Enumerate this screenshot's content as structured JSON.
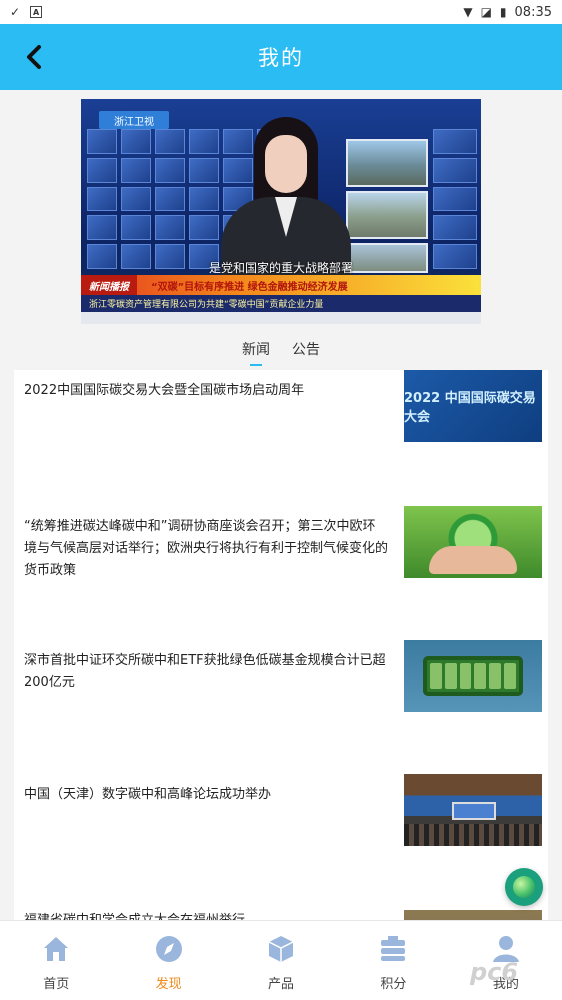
{
  "status_bar": {
    "time": "08:35"
  },
  "header": {
    "title": "我的"
  },
  "banner": {
    "channel_logo": "浙江卫视",
    "subtitle": "是党和国家的重大战略部署",
    "ticker_tag": "新闻播报",
    "ticker_text": "“双碳”目标有序推进  绿色金融推动经济发展",
    "ticker2_text": "浙江零碳资产管理有限公司为共建“零碳中国”贡献企业力量"
  },
  "tabs": [
    {
      "label": "新闻",
      "active": true
    },
    {
      "label": "公告",
      "active": false
    }
  ],
  "news": [
    {
      "title": "2022中国国际碳交易大会暨全国碳市场启动周年",
      "thumb": "2022 中国国际碳交易大会"
    },
    {
      "title": "“统筹推进碳达峰碳中和”调研协商座谈会召开；第三次中欧环境与气候高层对话举行；欧洲央行将执行有利于控制气候变化的货币政策",
      "thumb": ""
    },
    {
      "title": "深市首批中证环交所碳中和ETF获批绿色低碳基金规模合计已超200亿元",
      "thumb": ""
    },
    {
      "title": "中国（天津）数字碳中和高峰论坛成功举办",
      "thumb": ""
    },
    {
      "title": "福建省碳中和学会成立大会在福州举行",
      "thumb": ""
    }
  ],
  "bottom_nav": [
    {
      "label": "首页",
      "icon": "home-icon",
      "active": false
    },
    {
      "label": "发现",
      "icon": "compass-icon",
      "active": true
    },
    {
      "label": "产品",
      "icon": "box-icon",
      "active": false
    },
    {
      "label": "积分",
      "icon": "points-icon",
      "active": false
    },
    {
      "label": "我的",
      "icon": "user-icon",
      "active": false
    }
  ],
  "watermark": "pc6",
  "colors": {
    "header": "#2bbcf3",
    "nav_active": "#f08a1c"
  }
}
